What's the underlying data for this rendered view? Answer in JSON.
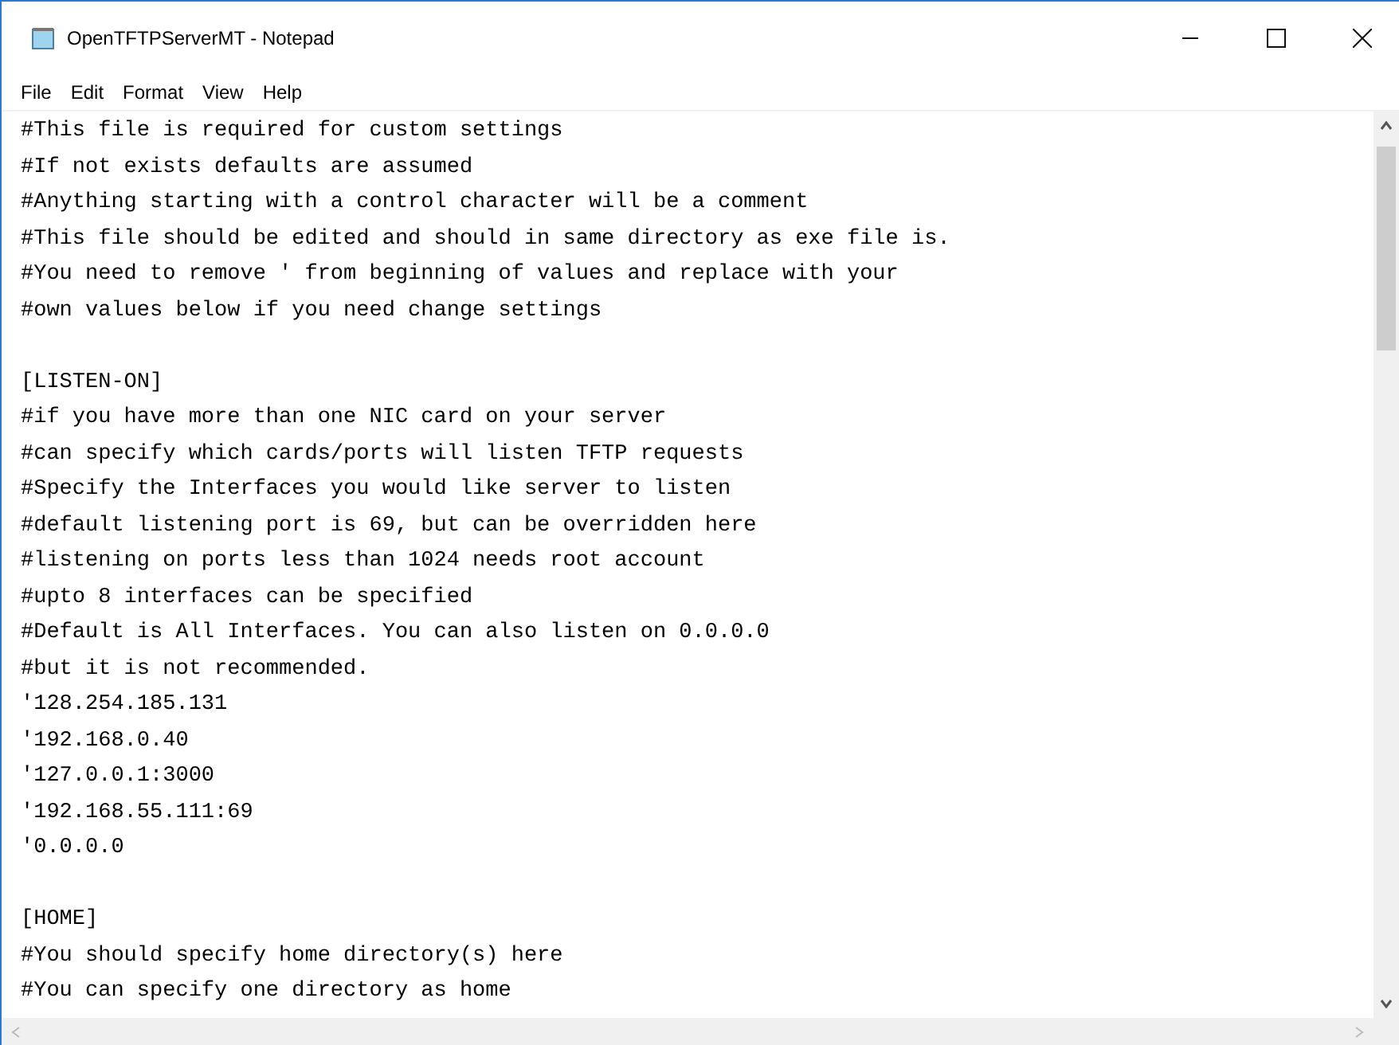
{
  "window": {
    "title": "OpenTFTPServerMT - Notepad"
  },
  "menu": [
    "File",
    "Edit",
    "Format",
    "View",
    "Help"
  ],
  "editor": {
    "paragraphs": [
      [
        "#This file is required for custom settings",
        "#If not exists defaults are assumed",
        "#Anything starting with a control character will be a comment",
        "#This file should be edited and should in same directory as exe file is.",
        "#You need to remove ' from beginning of values and replace with your",
        "#own values below if you need change settings"
      ],
      [
        "[LISTEN-ON]",
        "#if you have more than one NIC card on your server",
        "#can specify which cards/ports will listen TFTP requests",
        "#Specify the Interfaces you would like server to listen",
        "#default listening port is 69, but can be overridden here",
        "#listening on ports less than 1024 needs root account",
        "#upto 8 interfaces can be specified",
        "#Default is All Interfaces. You can also listen on 0.0.0.0",
        "#but it is not recommended.",
        "'128.254.185.131",
        "'192.168.0.40",
        "'127.0.0.1:3000",
        "'192.168.55.111:69",
        "'0.0.0.0"
      ],
      [
        "[HOME]",
        "#You should specify home directory(s) here",
        "#You can specify one directory as home"
      ]
    ]
  }
}
